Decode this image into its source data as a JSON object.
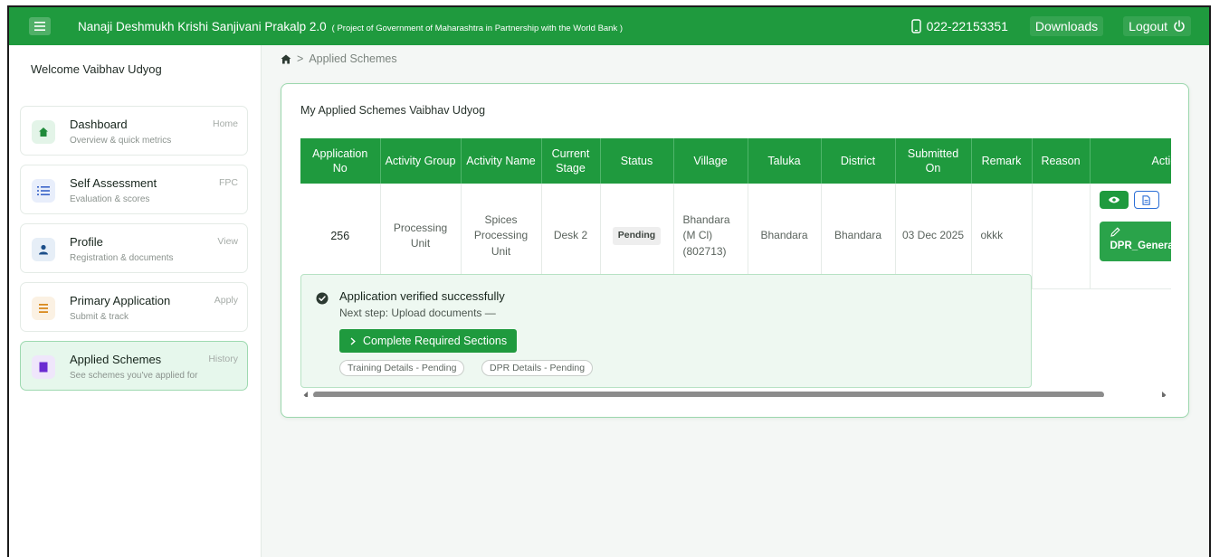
{
  "header": {
    "title": "Nanaji Deshmukh Krishi Sanjivani Prakalp 2.0",
    "subtitle": "( Project of Government of Maharashtra in Partnership with the World Bank )",
    "phone": "022-22153351",
    "downloads_label": "Downloads",
    "logout_label": "Logout"
  },
  "sidebar": {
    "welcome": "Welcome Vaibhav Udyog",
    "items": [
      {
        "title": "Dashboard",
        "sub": "Overview & quick metrics",
        "tag": "Home",
        "icon": "home-icon"
      },
      {
        "title": "Self Assessment",
        "sub": "Evaluation & scores",
        "tag": "FPC",
        "icon": "list-icon"
      },
      {
        "title": "Profile",
        "sub": "Registration & documents",
        "tag": "View",
        "icon": "user-icon"
      },
      {
        "title": "Primary Application",
        "sub": "Submit & track",
        "tag": "Apply",
        "icon": "form-icon"
      },
      {
        "title": "Applied Schemes",
        "sub": "See schemes you've applied for",
        "tag": "History",
        "icon": "bookmark-icon"
      }
    ]
  },
  "breadcrumb": {
    "current": "Applied Schemes"
  },
  "card": {
    "title": "My Applied Schemes Vaibhav Udyog"
  },
  "table": {
    "headers": [
      "Application No",
      "Activity Group",
      "Activity Name",
      "Current Stage",
      "Status",
      "Village",
      "Taluka",
      "District",
      "Submitted On",
      "Remark",
      "Reason",
      "Actions"
    ],
    "row": {
      "application_no": "256",
      "activity_group": "Processing Unit",
      "activity_name": "Spices Processing Unit",
      "current_stage": "Desk 2",
      "status": "Pending",
      "village": "Bhandara (M Cl) (802713)",
      "taluka": "Bhandara",
      "district": "Bhandara",
      "submitted_on": "03 Dec 2025",
      "remark": "okkk",
      "reason": "",
      "dpr_button": "DPR_Generate"
    }
  },
  "verify": {
    "title": "Application verified successfully",
    "next_step": "Next step: Upload documents —",
    "button": "Complete Required Sections",
    "chips": [
      "Training Details - Pending",
      "DPR Details - Pending"
    ]
  },
  "colors": {
    "primary": "#1f9a3e",
    "active_bg": "#e6f7ec",
    "doc_blue": "#2b6fd6"
  }
}
